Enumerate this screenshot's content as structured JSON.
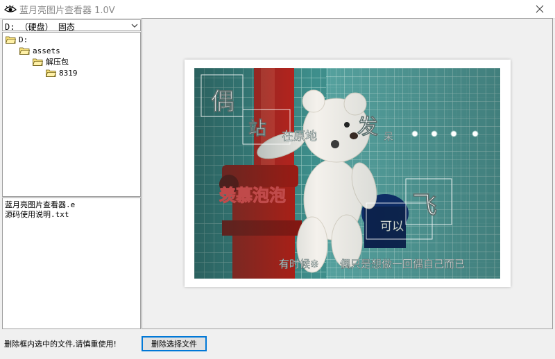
{
  "window": {
    "title": "蓝月亮图片查看器 1.0V",
    "icon": "eye-icon",
    "close_icon": "close-icon"
  },
  "drive_select": {
    "value": "D: （硬盘） 固态"
  },
  "folder_tree": {
    "items": [
      {
        "label": "D:"
      },
      {
        "label": "assets"
      },
      {
        "label": "解压包"
      },
      {
        "label": "8319"
      }
    ]
  },
  "file_list": {
    "items": [
      {
        "label": "蓝月亮图片查看器.e"
      },
      {
        "label": "源码使用说明.txt"
      }
    ]
  },
  "viewer": {
    "photo_overlay_text": {
      "t1": "偶",
      "t2": "站",
      "t3": "在原地",
      "t4": "发",
      "t5": "呆",
      "t6": "羡慕泡泡",
      "t7": "可以",
      "t8": "飞",
      "t9": "有时候※",
      "t10": "偶只是想做一回偶自己而已"
    }
  },
  "footer": {
    "warning": "删除框内选中的文件,请慎重使用!",
    "delete_button": "删除选择文件"
  },
  "colors": {
    "focus_border": "#0078d7",
    "panel_border": "#a0a0a0",
    "background": "#f0f0f0"
  }
}
